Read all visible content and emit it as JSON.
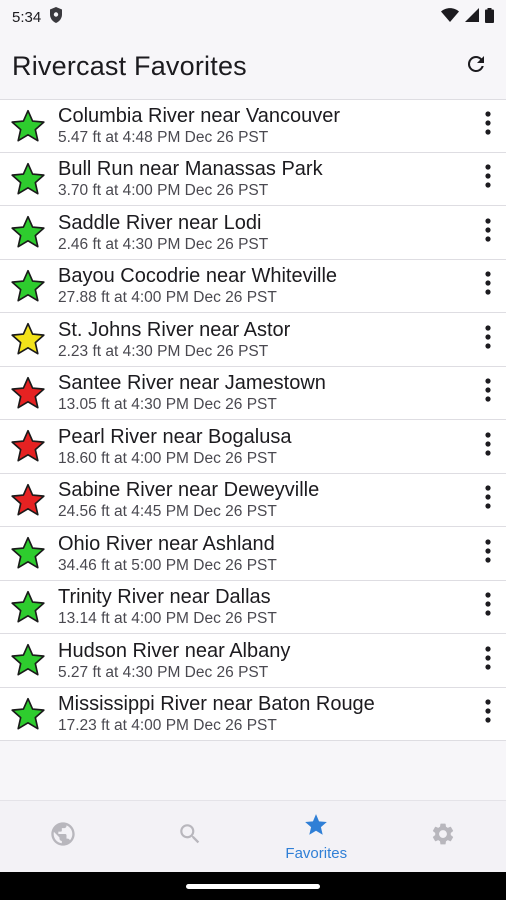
{
  "status": {
    "time": "5:34"
  },
  "header": {
    "title": "Rivercast Favorites"
  },
  "favorites": [
    {
      "name": "Columbia River near Vancouver",
      "reading": "5.47 ft at 4:48 PM Dec 26 PST",
      "status_color": "#2ecc2e"
    },
    {
      "name": "Bull Run near Manassas Park",
      "reading": "3.70 ft at 4:00 PM Dec 26 PST",
      "status_color": "#2ecc2e"
    },
    {
      "name": "Saddle River near Lodi",
      "reading": "2.46 ft at 4:30 PM Dec 26 PST",
      "status_color": "#2ecc2e"
    },
    {
      "name": "Bayou Cocodrie near Whiteville",
      "reading": "27.88 ft at 4:00 PM Dec 26 PST",
      "status_color": "#2ecc2e"
    },
    {
      "name": "St. Johns River near Astor",
      "reading": "2.23 ft at 4:30 PM Dec 26 PST",
      "status_color": "#f2e21a"
    },
    {
      "name": "Santee River near Jamestown",
      "reading": "13.05 ft at 4:30 PM Dec 26 PST",
      "status_color": "#e52222"
    },
    {
      "name": "Pearl River near Bogalusa",
      "reading": "18.60 ft at 4:00 PM Dec 26 PST",
      "status_color": "#e52222"
    },
    {
      "name": "Sabine River near Deweyville",
      "reading": "24.56 ft at 4:45 PM Dec 26 PST",
      "status_color": "#e52222"
    },
    {
      "name": "Ohio River near Ashland",
      "reading": "34.46 ft at 5:00 PM Dec 26 PST",
      "status_color": "#2ecc2e"
    },
    {
      "name": "Trinity River near Dallas",
      "reading": "13.14 ft at 4:00 PM Dec 26 PST",
      "status_color": "#2ecc2e"
    },
    {
      "name": "Hudson River near Albany",
      "reading": "5.27 ft at 4:30 PM Dec 26 PST",
      "status_color": "#2ecc2e"
    },
    {
      "name": "Mississippi River near Baton Rouge",
      "reading": "17.23 ft at 4:00 PM Dec 26 PST",
      "status_color": "#2ecc2e"
    }
  ],
  "bottom_nav": {
    "items": [
      {
        "icon": "globe-icon",
        "label": ""
      },
      {
        "icon": "search-icon",
        "label": ""
      },
      {
        "icon": "star-icon",
        "label": "Favorites",
        "active": true
      },
      {
        "icon": "gear-icon",
        "label": ""
      }
    ],
    "active_color": "#2f7fd6",
    "inactive_color": "#b8b7bd"
  }
}
